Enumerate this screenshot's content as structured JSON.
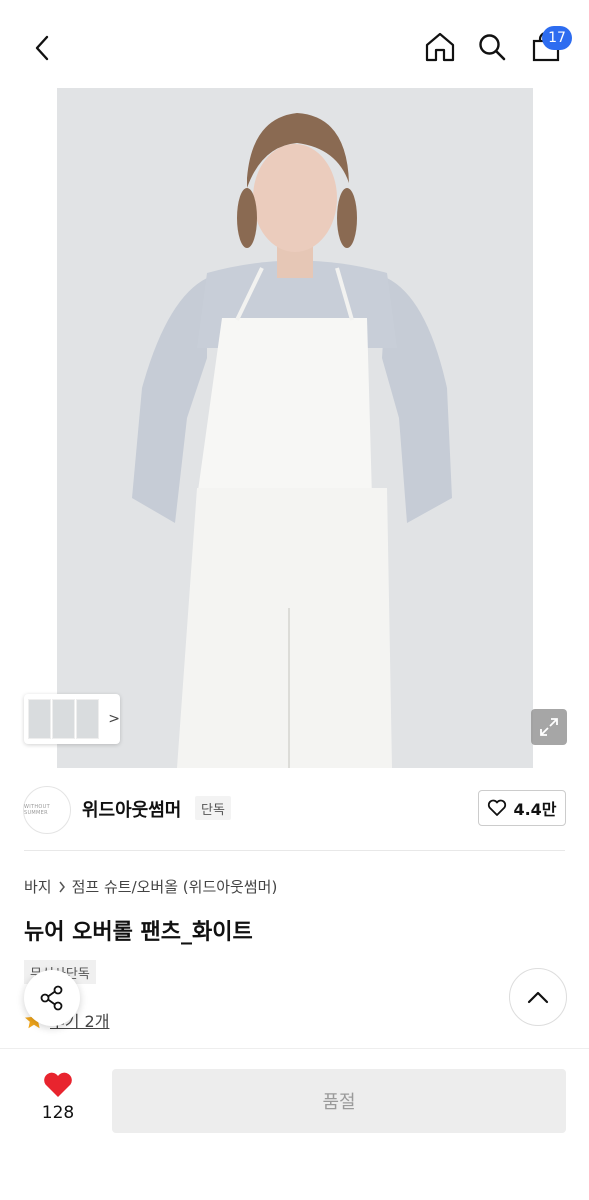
{
  "header": {
    "back_icon": "chevron-left-icon",
    "home_icon": "home-icon",
    "search_icon": "search-icon",
    "bag_icon": "shopping-bag-icon",
    "cart_count": "17",
    "badge_color": "#2d6cf0"
  },
  "gallery": {
    "thumbnails": [
      "thumbnail-1",
      "thumbnail-2",
      "thumbnail-3"
    ],
    "thumb_arrow": ">",
    "expand_icon": "expand-icon"
  },
  "brand": {
    "logo_text": "WITHOUT SUMMER",
    "name": "위드아웃썸머",
    "tag": "단독",
    "like_count": "4.4만",
    "like_icon": "heart-outline-icon"
  },
  "product": {
    "breadcrumb": [
      "바지",
      "점프 슈트/오버올 (위드아웃썸머)"
    ],
    "title": "뉴어 오버롤 팬츠_화이트",
    "exclusive_tag": "무신사단독",
    "review_icon": "star-icon",
    "review_text": "후기 2개"
  },
  "floating": {
    "share_icon": "share-icon",
    "scroll_top_icon": "chevron-up-icon"
  },
  "bottom_bar": {
    "wish_icon": "heart-filled-icon",
    "wish_count": "128",
    "soldout_label": "품절",
    "heart_color": "#e8242e"
  }
}
